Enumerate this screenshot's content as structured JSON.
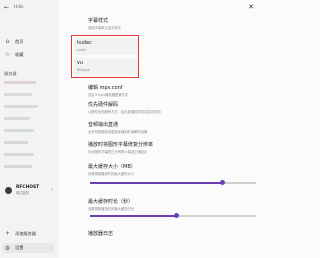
{
  "window": {
    "title": "Hills",
    "close_glyph": "✕",
    "back_glyph": "←"
  },
  "sidebar": {
    "nav": [
      {
        "label": "首页",
        "icon": "home-icon",
        "glyph": "⌂"
      },
      {
        "label": "收藏",
        "icon": "star-icon",
        "glyph": "☆"
      }
    ],
    "servers_section": "服务器",
    "server": {
      "name": "RFCHOST",
      "sub": "前往复制",
      "chevron": "‹"
    },
    "bottom": [
      {
        "label": "添加服务器",
        "icon": "plus-icon",
        "glyph": "+"
      },
      {
        "label": "设置",
        "icon": "gear-icon",
        "glyph": "⚙"
      }
    ]
  },
  "settings": {
    "subtitle_style": {
      "title": "字幕样式",
      "sub": "选择字幕默认显示样式"
    },
    "language_cards": [
      {
        "title": "hudec",
        "sub": "audio"
      },
      {
        "title": "vu",
        "sub": "Bilingus"
      }
    ],
    "edit_mpv": {
      "title": "编辑 mpv.conf",
      "sub": "自定义mpv播放器配置文件"
    },
    "hw_decode": {
      "title": "优先硬件解码",
      "sub": "以硬件优先解码方式，如出现播放异常请尝试关闭"
    },
    "audio_passthrough": {
      "title": "音频输出直通",
      "sub": "允许将音频码流直接传输到外部解码设备"
    },
    "subtitle_fix": {
      "title": "播放时将图形字幕修复分辨率",
      "sub": "针对图形字幕修正分辨率以保证正确显示"
    },
    "cache_size": {
      "title": "最大缓存大小（MB）",
      "sub": "设置视频播放时的最大缓存大小",
      "value_fraction": 0.8
    },
    "cache_time": {
      "title": "最大缓存时长（秒）",
      "sub": "设置视频播放时的最大缓存时长",
      "value_fraction": 0.52
    },
    "player_log": {
      "title": "播放器日志"
    }
  },
  "colors": {
    "accent": "#6a3fb5",
    "highlight": "#e53935"
  }
}
